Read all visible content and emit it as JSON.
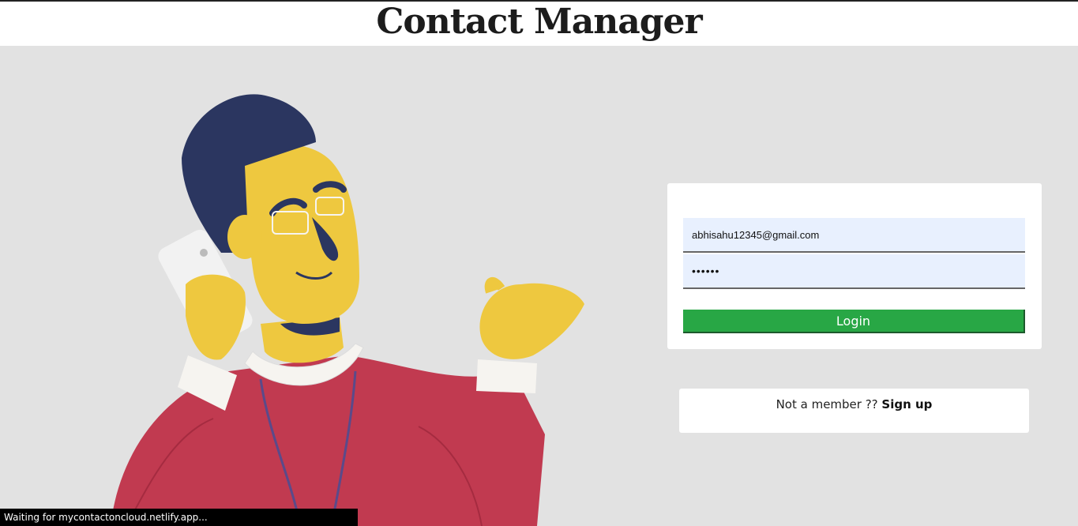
{
  "header": {
    "title": "Contact Manager"
  },
  "login": {
    "email_value": "abhisahu12345@gmail.com",
    "password_value": "abc123",
    "button_label": "Login"
  },
  "signup": {
    "prompt": "Not a member ?? ",
    "link_label": "Sign up"
  },
  "status_bar": {
    "text": "Waiting for mycontactoncloud.netlify.app..."
  },
  "colors": {
    "page_background": "#e2e2e2",
    "login_button": "#28a745",
    "input_background": "#e8f0fe",
    "sweater": "#c13a50",
    "skin": "#eec83f",
    "hair": "#2b3660"
  },
  "illustration": {
    "icon": "man-on-phone-illustration"
  }
}
